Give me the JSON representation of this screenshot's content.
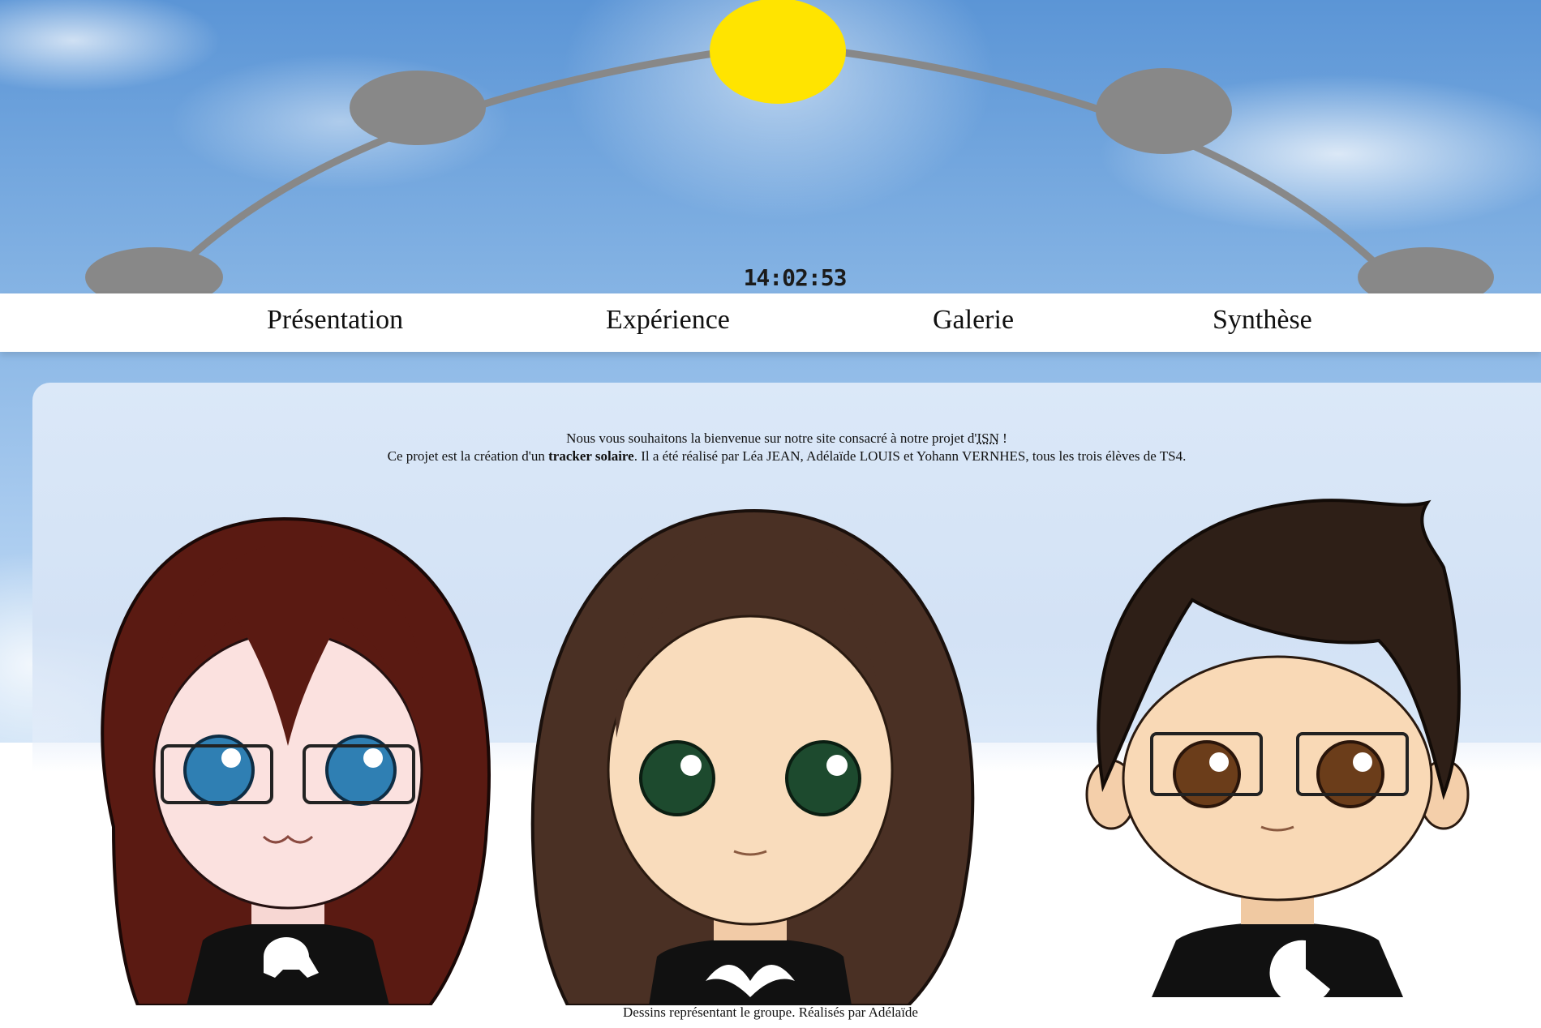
{
  "header": {
    "clock": "14:02:53",
    "sun_color": "#ffe400",
    "arc_color": "#888888",
    "arc_markers": [
      "sun-position-marker"
    ]
  },
  "nav": {
    "items": [
      {
        "label": "Présentation"
      },
      {
        "label": "Expérience"
      },
      {
        "label": "Galerie"
      },
      {
        "label": "Synthèse"
      }
    ]
  },
  "main": {
    "welcome_line1_prefix": "Nous vous souhaitons la bienvenue sur notre site consacré à notre projet d'",
    "welcome_isn": "ISN",
    "welcome_line1_suffix": " !",
    "welcome_line2_prefix": "Ce projet est la création d'un ",
    "welcome_bold": "tracker solaire",
    "welcome_line2_suffix": ". Il a été réalisé par Léa JEAN, Adélaïde LOUIS et Yohann VERNHES, tous les trois élèves de TS4.",
    "caption": "Dessins représentant le groupe. Réalisés par Adélaïde"
  },
  "characters": [
    {
      "name": "character-lea",
      "eye_color": "#2f7fb3",
      "hair_color": "#5a1a12",
      "shirt_icon": "skull-icon"
    },
    {
      "name": "character-adelaide",
      "eye_color": "#1d4a2e",
      "hair_color": "#4a3024",
      "shirt_icon": "tribal-icon"
    },
    {
      "name": "character-yohann",
      "eye_color": "#6b3d1a",
      "hair_color": "#2e1f17",
      "shirt_icon": "pacman-icon"
    }
  ]
}
